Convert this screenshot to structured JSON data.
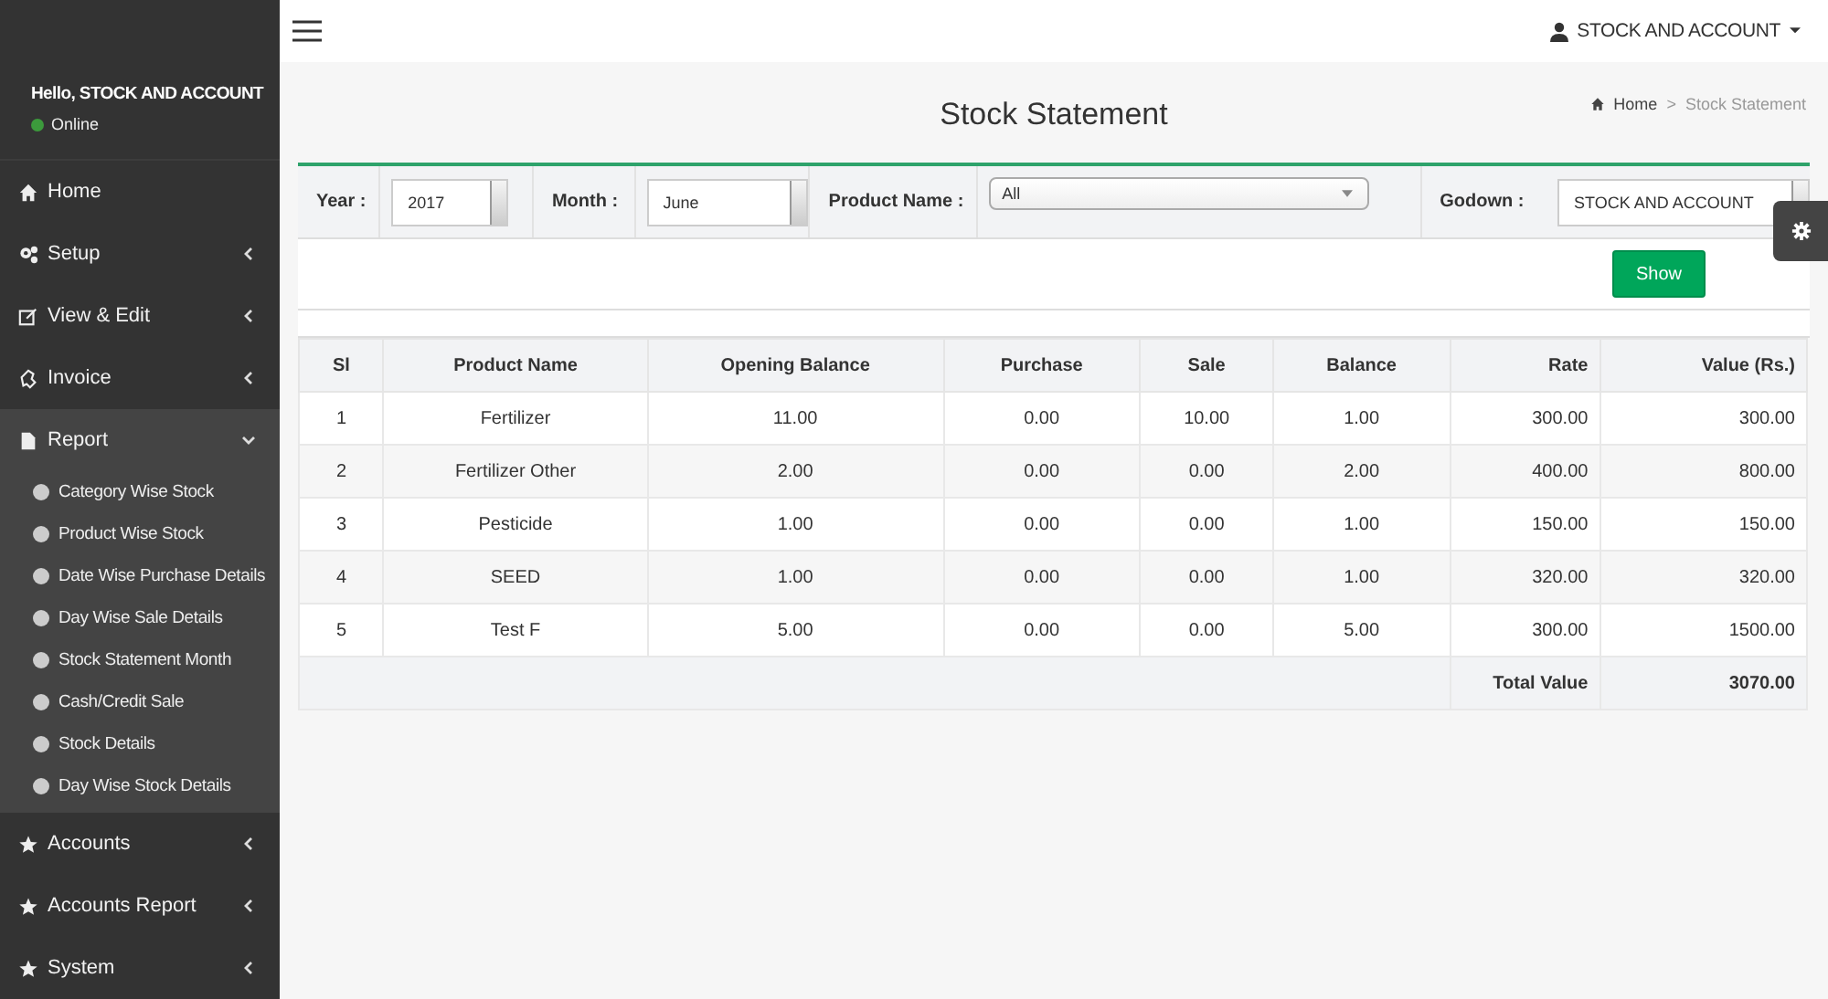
{
  "sidebar": {
    "greeting": "Hello, STOCK AND ACCOUNT",
    "status": "Online",
    "items": [
      {
        "label": "Home"
      },
      {
        "label": "Setup",
        "expanded": false
      },
      {
        "label": "View & Edit",
        "expanded": false
      },
      {
        "label": "Invoice",
        "expanded": false
      },
      {
        "label": "Report",
        "expanded": true,
        "children": [
          {
            "label": "Category Wise Stock"
          },
          {
            "label": "Product Wise Stock"
          },
          {
            "label": "Date Wise Purchase Details"
          },
          {
            "label": "Day Wise Sale Details"
          },
          {
            "label": "Stock Statement Month"
          },
          {
            "label": "Cash/Credit Sale"
          },
          {
            "label": "Stock Details"
          },
          {
            "label": "Day Wise Stock Details"
          }
        ]
      },
      {
        "label": "Accounts",
        "expanded": false
      },
      {
        "label": "Accounts Report",
        "expanded": false
      },
      {
        "label": "System",
        "expanded": false
      }
    ]
  },
  "header": {
    "user": "STOCK AND ACCOUNT"
  },
  "page": {
    "title": "Stock Statement",
    "breadcrumb": [
      "Home",
      ">",
      "Stock Statement"
    ]
  },
  "filters": {
    "year_label": "Year :",
    "year": "2017",
    "month_label": "Month :",
    "month": "June",
    "product_label": "Product Name :",
    "product": "All",
    "godown_label": "Godown :",
    "godown": "STOCK AND ACCOUNT",
    "show_button": "Show"
  },
  "table": {
    "columns": [
      "Sl",
      "Product Name",
      "Opening Balance",
      "Purchase",
      "Sale",
      "Balance",
      "Rate",
      "Value (Rs.)"
    ],
    "rows": [
      [
        "1",
        "Fertilizer",
        "11.00",
        "0.00",
        "10.00",
        "1.00",
        "300.00",
        "300.00"
      ],
      [
        "2",
        "Fertilizer Other",
        "2.00",
        "0.00",
        "0.00",
        "2.00",
        "400.00",
        "800.00"
      ],
      [
        "3",
        "Pesticide",
        "1.00",
        "0.00",
        "0.00",
        "1.00",
        "150.00",
        "150.00"
      ],
      [
        "4",
        "SEED",
        "1.00",
        "0.00",
        "0.00",
        "1.00",
        "320.00",
        "320.00"
      ],
      [
        "5",
        "Test F",
        "5.00",
        "0.00",
        "0.00",
        "5.00",
        "300.00",
        "1500.00"
      ]
    ],
    "total_label": "Total Value",
    "total_value": "3070.00"
  }
}
